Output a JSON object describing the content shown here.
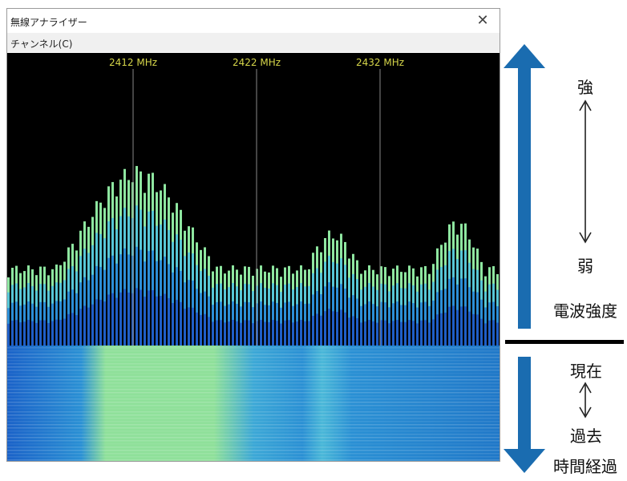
{
  "window": {
    "title": "無線アナライザー",
    "close_glyph": "✕",
    "menu": [
      {
        "label": "チャンネル(C)"
      }
    ]
  },
  "spectrum": {
    "frequency_markers": [
      {
        "label": "2412 MHz"
      },
      {
        "label": "2422 MHz"
      },
      {
        "label": "2432 MHz"
      }
    ],
    "marker_color": "#d6d64a",
    "bar_colors": [
      "#1414a8",
      "#1f5ec6",
      "#2c8ed6",
      "#57c6d6",
      "#8ee6a0"
    ]
  },
  "annotations": {
    "strength": {
      "strong": "強",
      "weak": "弱",
      "label": "電波強度"
    },
    "time": {
      "now": "現在",
      "past": "過去",
      "label": "時間経過"
    },
    "arrow_color": "#1a6cb0"
  }
}
